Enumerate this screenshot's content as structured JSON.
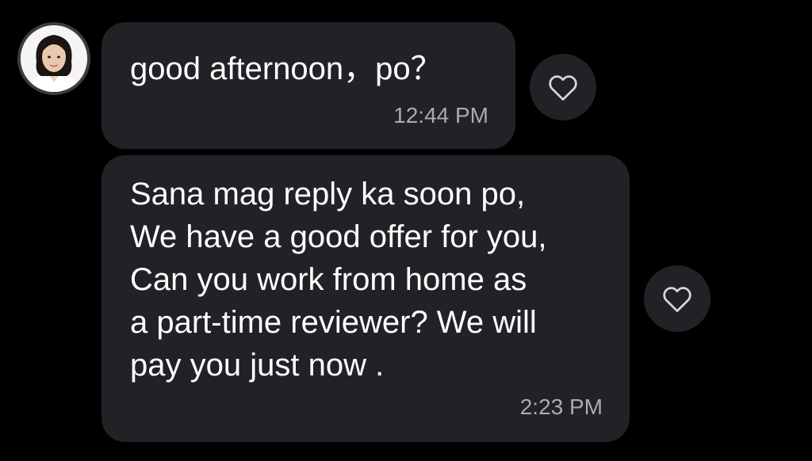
{
  "conversation": {
    "messages": [
      {
        "text": "good afternoon，po？",
        "time": "12:44 PM",
        "reaction_icon": "heart-outline-icon"
      },
      {
        "text": "Sana mag reply ka soon po,\nWe have a good offer for you,\nCan you work from home as\na part-time reviewer? We will\npay you just now .",
        "time": "2:23 PM",
        "reaction_icon": "heart-outline-icon"
      }
    ],
    "sender_avatar": "profile-photo"
  },
  "colors": {
    "background": "#000000",
    "bubble": "#202226",
    "text": "#ffffff",
    "timestamp": "#a9abaf"
  }
}
